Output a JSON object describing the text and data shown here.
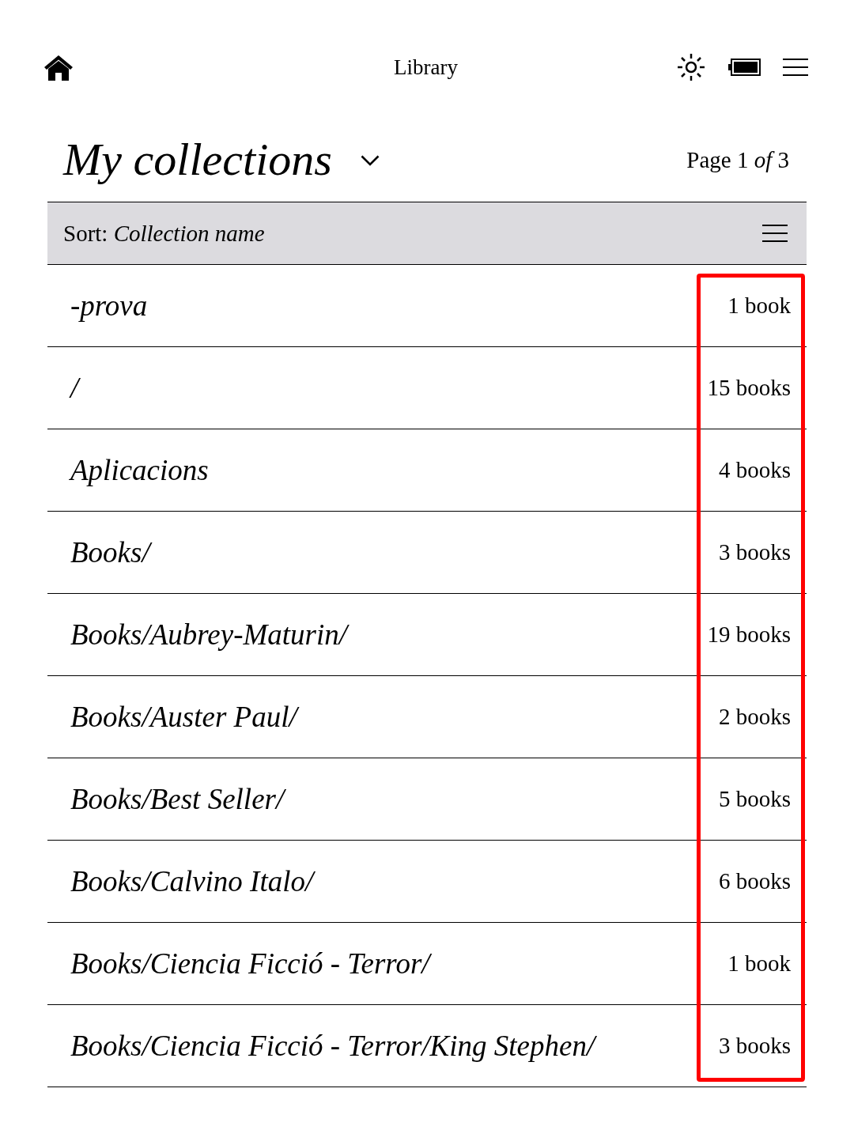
{
  "top_bar": {
    "title": "Library"
  },
  "header": {
    "title": "My collections",
    "page_indicator": "Page 1 *of* 3"
  },
  "sort_bar": {
    "label": "Sort: *Collection name*"
  },
  "collections": {
    "counts_highlighted": true,
    "items": [
      {
        "name": "-prova",
        "count": "1 book"
      },
      {
        "name": "/",
        "count": "15 books"
      },
      {
        "name": "Aplicacions",
        "count": "4 books"
      },
      {
        "name": "Books/",
        "count": "3 books"
      },
      {
        "name": "Books/Aubrey-Maturin/",
        "count": "19 books"
      },
      {
        "name": "Books/Auster Paul/",
        "count": "2 books"
      },
      {
        "name": "Books/Best Seller/",
        "count": "5 books"
      },
      {
        "name": "Books/Calvino Italo/",
        "count": "6 books"
      },
      {
        "name": "Books/Ciencia Ficció - Terror/",
        "count": "1 book"
      },
      {
        "name": "Books/Ciencia Ficció - Terror/King Stephen/",
        "count": "3 books"
      }
    ]
  }
}
